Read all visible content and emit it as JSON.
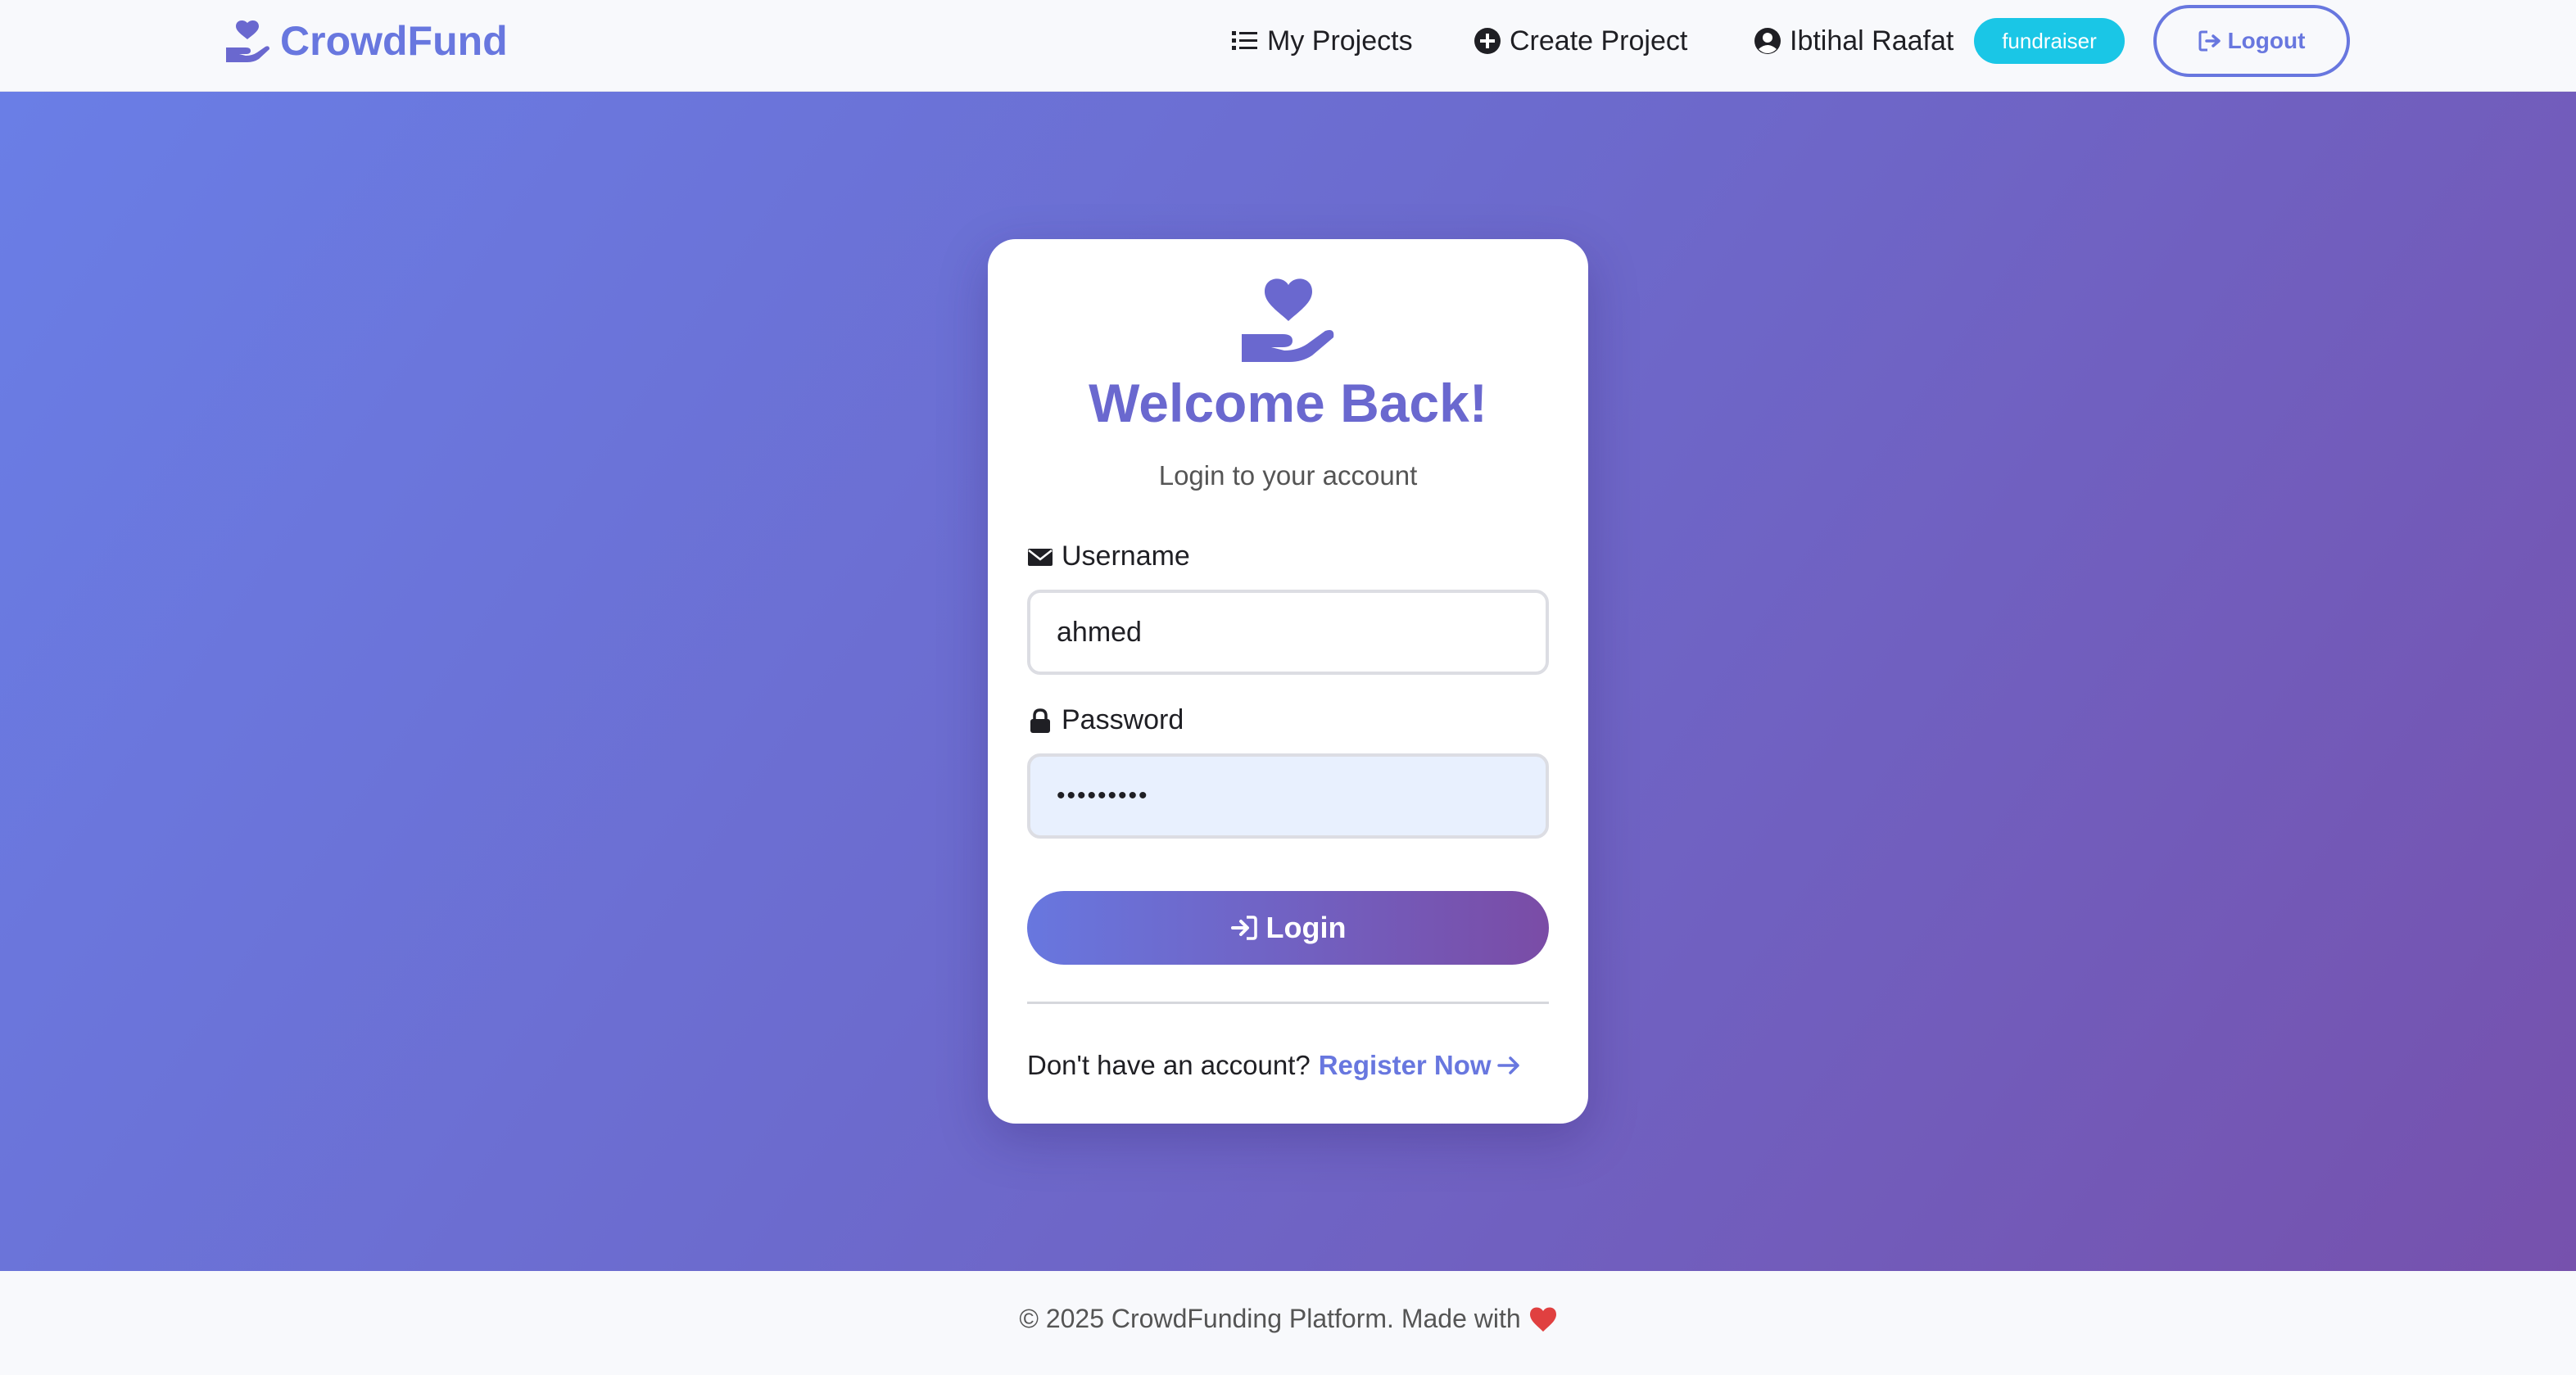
{
  "navbar": {
    "brand": "CrowdFund",
    "links": {
      "my_projects": "My Projects",
      "create_project": "Create Project"
    },
    "user_name": "Ibtihal Raafat",
    "role_badge": "fundraiser",
    "logout_label": "Logout"
  },
  "login_card": {
    "title": "Welcome Back!",
    "subtitle": "Login to your account",
    "username_label": "Username",
    "username_value": "ahmed",
    "password_label": "Password",
    "password_value": "•••••••••",
    "login_button": "Login",
    "register_prompt": "Don't have an account?",
    "register_link": "Register Now"
  },
  "footer": {
    "text": "© 2025 CrowdFunding Platform. Made with"
  },
  "icons": {
    "brand": "hand-holding-heart-icon",
    "my_projects": "list-icon",
    "create_project": "plus-circle-icon",
    "user": "user-circle-icon",
    "logout": "sign-out-icon",
    "username": "envelope-icon",
    "password": "lock-icon",
    "login": "sign-in-icon",
    "register": "arrow-right-icon",
    "footer": "heart-icon"
  },
  "colors": {
    "primary": "#6877df",
    "secondary": "#764ba2",
    "badge": "#1ac6e6",
    "heart": "#e04040"
  }
}
